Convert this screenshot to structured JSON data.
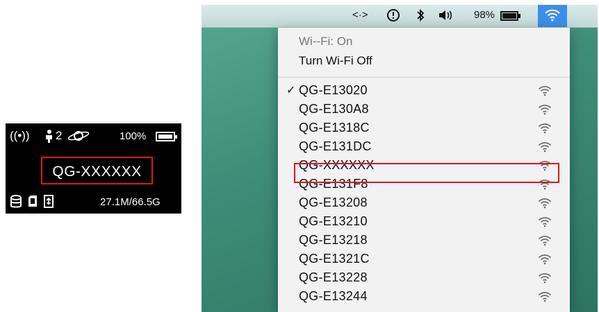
{
  "device": {
    "network_count": "2",
    "battery_percent": "100%",
    "battery_level": 1.0,
    "ssid": "QG-XXXXXX",
    "storage": "27.1M/66.5G",
    "icons": [
      "signal-broadcast-icon",
      "connected-users-icon",
      "internet-globe-icon",
      "battery-icon",
      "database-icon",
      "sd-card-icon",
      "usb-icon"
    ]
  },
  "menubar": {
    "items": [
      {
        "name": "network-arrows-icon",
        "text": "<·>"
      },
      {
        "name": "time-machine-icon",
        "text": "⟲"
      },
      {
        "name": "bluetooth-icon",
        "text": "✱"
      },
      {
        "name": "volume-icon",
        "text": "◀)"
      }
    ],
    "battery_percent": "98%",
    "battery_level": 0.98
  },
  "wifi_menu": {
    "status": "Wi--Fi: On",
    "toggle_label": "Turn Wi-Fi Off",
    "highlight_color": "#e3141b",
    "networks": [
      {
        "name": "QG-E13020",
        "checked": true
      },
      {
        "name": "QG-E130A8",
        "checked": false
      },
      {
        "name": "QG-E1318C",
        "checked": false
      },
      {
        "name": "QG-E131DC",
        "checked": false
      },
      {
        "name": "QG-XXXXXX",
        "checked": false
      },
      {
        "name": "QG-E131F8",
        "checked": false
      },
      {
        "name": "QG-E13208",
        "checked": false
      },
      {
        "name": "QG-E13210",
        "checked": false
      },
      {
        "name": "QG-E13218",
        "checked": false
      },
      {
        "name": "QG-E1321C",
        "checked": false
      },
      {
        "name": "QG-E13228",
        "checked": false
      },
      {
        "name": "QG-E13244",
        "checked": false
      }
    ]
  }
}
